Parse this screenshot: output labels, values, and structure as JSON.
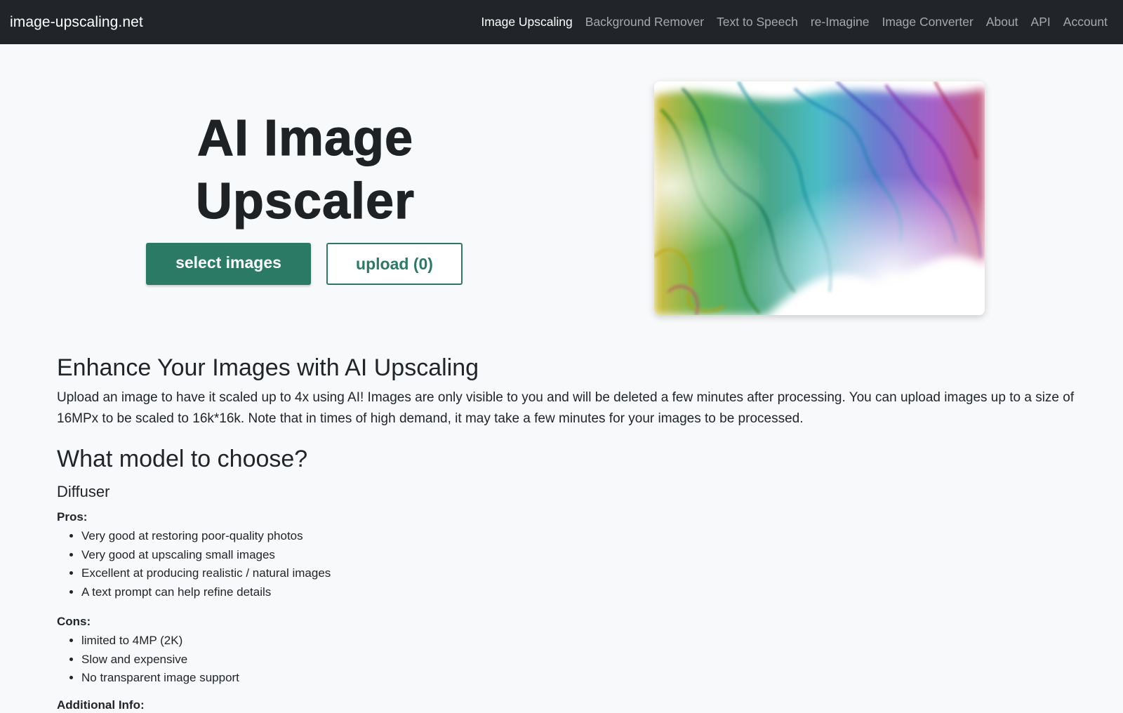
{
  "nav": {
    "brand": "image-upscaling.net",
    "links": [
      {
        "label": "Image Upscaling",
        "active": true
      },
      {
        "label": "Background Remover",
        "active": false
      },
      {
        "label": "Text to Speech",
        "active": false
      },
      {
        "label": "re-Imagine",
        "active": false
      },
      {
        "label": "Image Converter",
        "active": false
      },
      {
        "label": "About",
        "active": false
      },
      {
        "label": "API",
        "active": false
      },
      {
        "label": "Account",
        "active": false
      }
    ]
  },
  "hero": {
    "title_line1": "AI Image",
    "title_line2": "Upscaler",
    "select_label": "select images",
    "upload_label": "upload (0)",
    "image_subject": "rainbow-smoke-image"
  },
  "intro": {
    "heading": "Enhance Your Images with AI Upscaling",
    "text": "Upload an image to have it scaled up to 4x using AI! Images are only visible to you and will be deleted a few minutes after processing. You can upload images up to a size of 16MPx to be scaled to 16k*16k. Note that in times of high demand, it may take a few minutes for your images to be processed."
  },
  "models": {
    "heading": "What model to choose?",
    "model_name": "Diffuser",
    "pros_label": "Pros:",
    "pros": [
      "Very good at restoring poor-quality photos",
      "Very good at upscaling small images",
      "Excellent at producing realistic / natural images",
      "A text prompt can help refine details"
    ],
    "cons_label": "Cons:",
    "cons": [
      "limited to 4MP (2K)",
      "Slow and expensive",
      "No transparent image support"
    ],
    "additional_label": "Additional Info:"
  },
  "colors": {
    "navbar": "#212529",
    "accent": "#2b7a66",
    "background": "#f8f9fa"
  }
}
